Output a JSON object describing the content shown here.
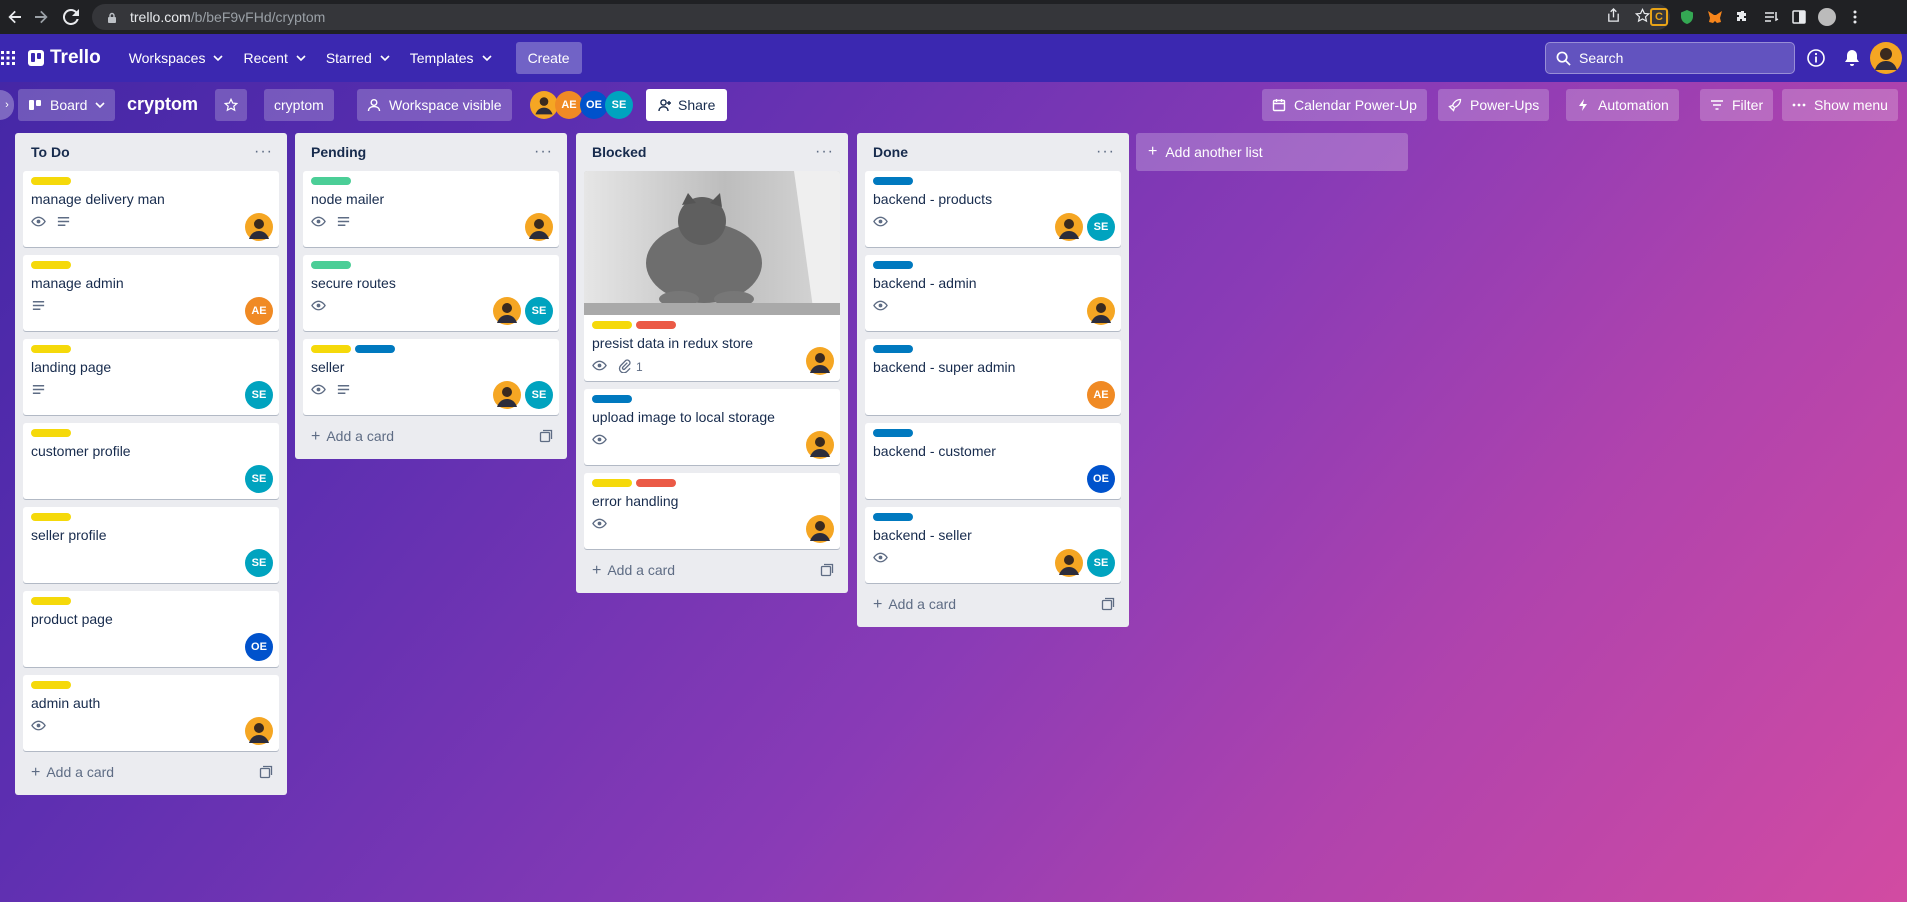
{
  "browser": {
    "url_host": "trello.com",
    "url_path": "/b/beF9vFHd/cryptom"
  },
  "header": {
    "logo": "Trello",
    "menus": [
      {
        "label": "Workspaces"
      },
      {
        "label": "Recent"
      },
      {
        "label": "Starred"
      },
      {
        "label": "Templates"
      }
    ],
    "create_label": "Create",
    "search_placeholder": "Search"
  },
  "board": {
    "view_label": "Board",
    "title": "cryptom",
    "workspace_label": "cryptom",
    "visibility_label": "Workspace visible",
    "share_label": "Share",
    "members": [
      {
        "initials": "",
        "color": "#f5a623",
        "photo": true
      },
      {
        "initials": "AE",
        "color": "#f08a24"
      },
      {
        "initials": "OE",
        "color": "#0052cc"
      },
      {
        "initials": "SE",
        "color": "#00a3bf"
      }
    ],
    "right_buttons": {
      "calendar": "Calendar Power-Up",
      "powerups": "Power-Ups",
      "automation": "Automation",
      "filter": "Filter",
      "show_menu": "Show menu"
    },
    "add_list_label": "Add another list"
  },
  "label_colors": {
    "yellow": "#f5d90a",
    "green": "#4bce97",
    "blue": "#0079bf",
    "red": "#eb5a46"
  },
  "avatar_colors": {
    "AE": "#f08a24",
    "SE": "#00a3bf",
    "OE": "#0052cc",
    "photo": "#f5a623"
  },
  "lists": [
    {
      "title": "To Do",
      "add_card_label": "Add a card",
      "cards": [
        {
          "title": "manage delivery man",
          "labels": [
            "yellow"
          ],
          "badges": [
            "watch",
            "description"
          ],
          "members": [
            "photo"
          ]
        },
        {
          "title": "manage admin",
          "labels": [
            "yellow"
          ],
          "badges": [
            "description"
          ],
          "members": [
            "AE"
          ]
        },
        {
          "title": "landing page",
          "labels": [
            "yellow"
          ],
          "badges": [
            "description"
          ],
          "members": [
            "SE"
          ]
        },
        {
          "title": "customer profile",
          "labels": [
            "yellow"
          ],
          "badges": [],
          "members": [
            "SE"
          ]
        },
        {
          "title": "seller profile",
          "labels": [
            "yellow"
          ],
          "badges": [],
          "members": [
            "SE"
          ]
        },
        {
          "title": "product page",
          "labels": [
            "yellow"
          ],
          "badges": [],
          "members": [
            "OE"
          ]
        },
        {
          "title": "admin auth",
          "labels": [
            "yellow"
          ],
          "badges": [
            "watch"
          ],
          "members": [
            "photo"
          ]
        }
      ]
    },
    {
      "title": "Pending",
      "add_card_label": "Add a card",
      "cards": [
        {
          "title": "node mailer",
          "labels": [
            "green"
          ],
          "badges": [
            "watch",
            "description"
          ],
          "members": [
            "photo"
          ]
        },
        {
          "title": "secure routes",
          "labels": [
            "green"
          ],
          "badges": [
            "watch"
          ],
          "members": [
            "photo",
            "SE"
          ]
        },
        {
          "title": "seller",
          "labels": [
            "yellow",
            "blue"
          ],
          "badges": [
            "watch",
            "description"
          ],
          "members": [
            "photo",
            "SE"
          ]
        }
      ]
    },
    {
      "title": "Blocked",
      "add_card_label": "Add a card",
      "cards": [
        {
          "title": "presist data in redux store",
          "cover": true,
          "labels": [
            "yellow",
            "red"
          ],
          "badges": [
            "watch",
            "attachment"
          ],
          "attachment_count": "1",
          "members": [
            "photo"
          ]
        },
        {
          "title": "upload image to local storage",
          "labels": [
            "blue"
          ],
          "badges": [
            "watch"
          ],
          "members": [
            "photo"
          ]
        },
        {
          "title": "error handling",
          "labels": [
            "yellow",
            "red"
          ],
          "badges": [
            "watch"
          ],
          "members": [
            "photo"
          ]
        }
      ]
    },
    {
      "title": "Done",
      "add_card_label": "Add a card",
      "cards": [
        {
          "title": "backend - products",
          "labels": [
            "blue"
          ],
          "badges": [
            "watch"
          ],
          "members": [
            "photo",
            "SE"
          ]
        },
        {
          "title": "backend - admin",
          "labels": [
            "blue"
          ],
          "badges": [
            "watch"
          ],
          "members": [
            "photo"
          ]
        },
        {
          "title": "backend - super admin",
          "labels": [
            "blue"
          ],
          "badges": [],
          "members": [
            "AE"
          ]
        },
        {
          "title": "backend - customer",
          "labels": [
            "blue"
          ],
          "badges": [],
          "members": [
            "OE"
          ]
        },
        {
          "title": "backend - seller",
          "labels": [
            "blue"
          ],
          "badges": [
            "watch"
          ],
          "members": [
            "photo",
            "SE"
          ]
        }
      ]
    }
  ]
}
